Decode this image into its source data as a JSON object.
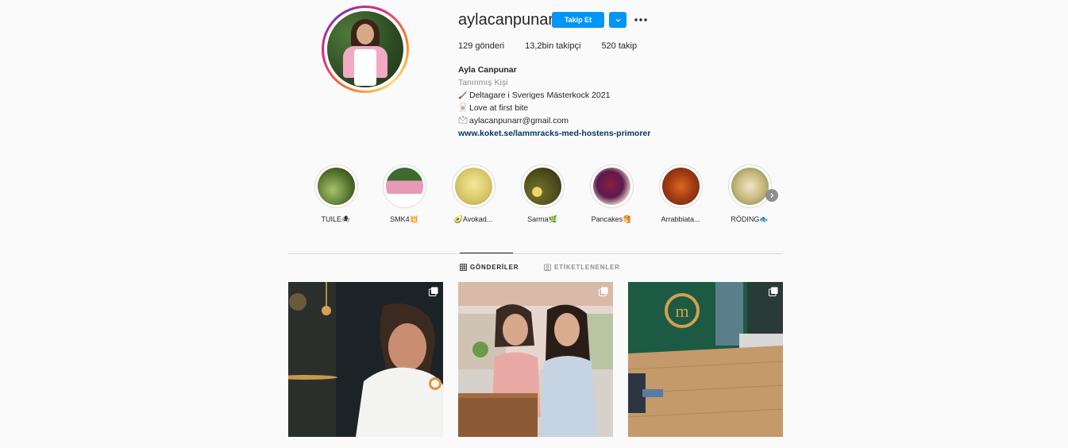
{
  "profile": {
    "username": "aylacanpunar",
    "follow_label": "Takip Et",
    "stats": {
      "posts": "129 gönderi",
      "followers": "13,2bin takipçi",
      "following": "520 takip"
    },
    "bio": {
      "name": "Ayla Canpunar",
      "category": "Tanınmış Kişi",
      "line1": "Deltagare i Sveriges Mästerkock 2021",
      "line2": "Love at first bite",
      "line3": "aylacanpunarr@gmail.com",
      "link": "www.koket.se/lammracks-med-hostens-primorer"
    }
  },
  "highlights": [
    {
      "label": "TUILE🕷"
    },
    {
      "label": "SMK4💥"
    },
    {
      "label": "🥑Avokad..."
    },
    {
      "label": "Sarma🌿"
    },
    {
      "label": "Pancakes🥞"
    },
    {
      "label": "Arrabbiata..."
    },
    {
      "label": "RÖDING🐟"
    }
  ],
  "tabs": {
    "posts": "GÖNDERİLER",
    "tagged": "ETİKETLENENLER"
  },
  "colors": {
    "accent": "#0095f6",
    "link": "#00376b",
    "muted": "#8e8e8e",
    "text": "#262626"
  }
}
